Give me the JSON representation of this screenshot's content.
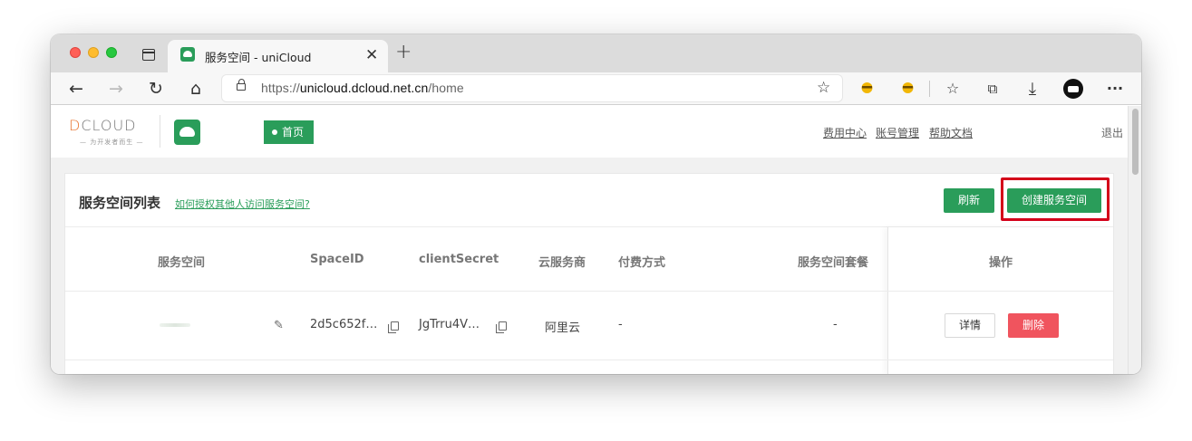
{
  "browser": {
    "tab": {
      "title": "服务空间 - uniCloud",
      "close_label": "✕",
      "new_tab_label": "+"
    },
    "toolbar": {
      "url_prefix": "https://",
      "url_host": "unicloud.dcloud.net.cn",
      "url_path": "/home",
      "more_label": "···"
    }
  },
  "header": {
    "logo_text_d": "D",
    "logo_text_rest": "CLOUD",
    "logo_subtitle": "— 为开发者而生 —",
    "nav_home": "首页",
    "links": [
      "费用中心",
      "账号管理",
      "帮助文档"
    ],
    "logout": "退出"
  },
  "panel": {
    "title": "服务空间列表",
    "help_link": "如何授权其他人访问服务空间?",
    "refresh_button": "刷新",
    "create_button": "创建服务空间",
    "columns": [
      "服务空间",
      "SpaceID",
      "clientSecret",
      "云服务商",
      "付费方式",
      "服务空间套餐",
      "操作"
    ],
    "rows": [
      {
        "space_id": "2d5c652f…",
        "client_secret": "JgTrru4V…",
        "provider": "阿里云",
        "payment": "-",
        "plan": "-",
        "detail_button": "详情",
        "delete_button": "删除"
      }
    ]
  },
  "colors": {
    "brand_green": "#2a9d5a",
    "danger_red": "#f0545e",
    "highlight_red": "#d4001a"
  }
}
